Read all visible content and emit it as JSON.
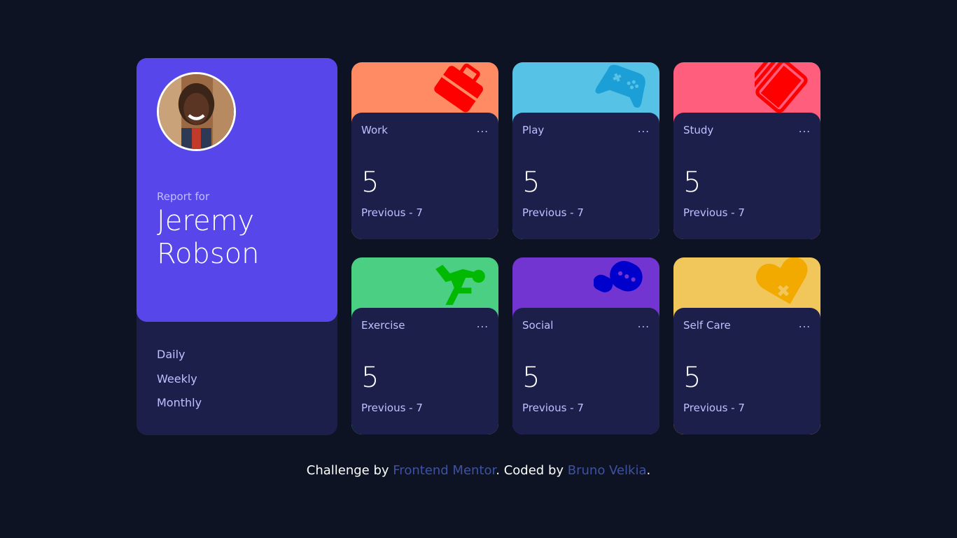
{
  "profile": {
    "report_for": "Report for",
    "name": "Jeremy Robson",
    "periods": [
      "Daily",
      "Weekly",
      "Monthly"
    ],
    "accent": "#5747ea"
  },
  "cards": [
    {
      "title": "Work",
      "menu": "...",
      "current": "5",
      "previous": "Previous - 7",
      "color": "#ff8b64",
      "icon": "briefcase-icon"
    },
    {
      "title": "Play",
      "menu": "...",
      "current": "5",
      "previous": "Previous - 7",
      "color": "#55c2e6",
      "icon": "gamepad-icon"
    },
    {
      "title": "Study",
      "menu": "...",
      "current": "5",
      "previous": "Previous - 7",
      "color": "#ff5e7d",
      "icon": "books-icon"
    },
    {
      "title": "Exercise",
      "menu": "...",
      "current": "5",
      "previous": "Previous - 7",
      "color": "#4bcf82",
      "icon": "runner-icon"
    },
    {
      "title": "Social",
      "menu": "...",
      "current": "5",
      "previous": "Previous - 7",
      "color": "#7335d2",
      "icon": "chat-bubbles-icon"
    },
    {
      "title": "Self Care",
      "menu": "...",
      "current": "5",
      "previous": "Previous - 7",
      "color": "#f1c65b",
      "icon": "heart-icon"
    }
  ],
  "footer": {
    "prefix": "Challenge by ",
    "link1": "Frontend Mentor",
    "middle": ". Coded by ",
    "link2": "Bruno Velkia",
    "suffix": "."
  }
}
